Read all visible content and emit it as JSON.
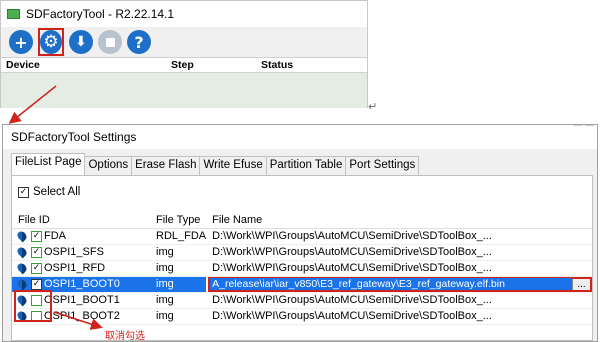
{
  "main_window": {
    "title": "SDFactoryTool - R2.22.14.1",
    "toolbar": [
      "add-icon",
      "gear-icon",
      "download-icon",
      "stop-icon",
      "help-icon"
    ],
    "columns": [
      "Device",
      "Step",
      "Status"
    ]
  },
  "settings": {
    "title": "SDFactoryTool Settings",
    "tabs": [
      "FileList Page",
      "Options",
      "Erase Flash",
      "Write Efuse",
      "Partition Table",
      "Port Settings"
    ],
    "select_all_label": "Select All",
    "columns": [
      "File ID",
      "File Type",
      "File Name"
    ],
    "rows": [
      {
        "id": "FDA",
        "type": "RDL_FDA",
        "name": "D:\\Work\\WPI\\Groups\\AutoMCU\\SemiDrive\\SDToolBox_...",
        "checked": true
      },
      {
        "id": "OSPI1_SFS",
        "type": "img",
        "name": "D:\\Work\\WPI\\Groups\\AutoMCU\\SemiDrive\\SDToolBox_...",
        "checked": true
      },
      {
        "id": "OSPI1_RFD",
        "type": "img",
        "name": "D:\\Work\\WPI\\Groups\\AutoMCU\\SemiDrive\\SDToolBox_...",
        "checked": true
      },
      {
        "id": "OSPI1_BOOT0",
        "type": "img",
        "name": "A_release\\iar\\iar_v850\\E3_ref_gateway\\E3_ref_gateway.elf.bin",
        "checked": true,
        "selected": true
      },
      {
        "id": "OSPI1_BOOT1",
        "type": "img",
        "name": "D:\\Work\\WPI\\Groups\\AutoMCU\\SemiDrive\\SDToolBox_...",
        "checked": false
      },
      {
        "id": "OSPI1_BOOT2",
        "type": "img",
        "name": "D:\\Work\\WPI\\Groups\\AutoMCU\\SemiDrive\\SDToolBox_...",
        "checked": false
      }
    ],
    "edit_button": "..."
  },
  "annotation": {
    "note": "取消勾选",
    "color": "#d0231b"
  }
}
